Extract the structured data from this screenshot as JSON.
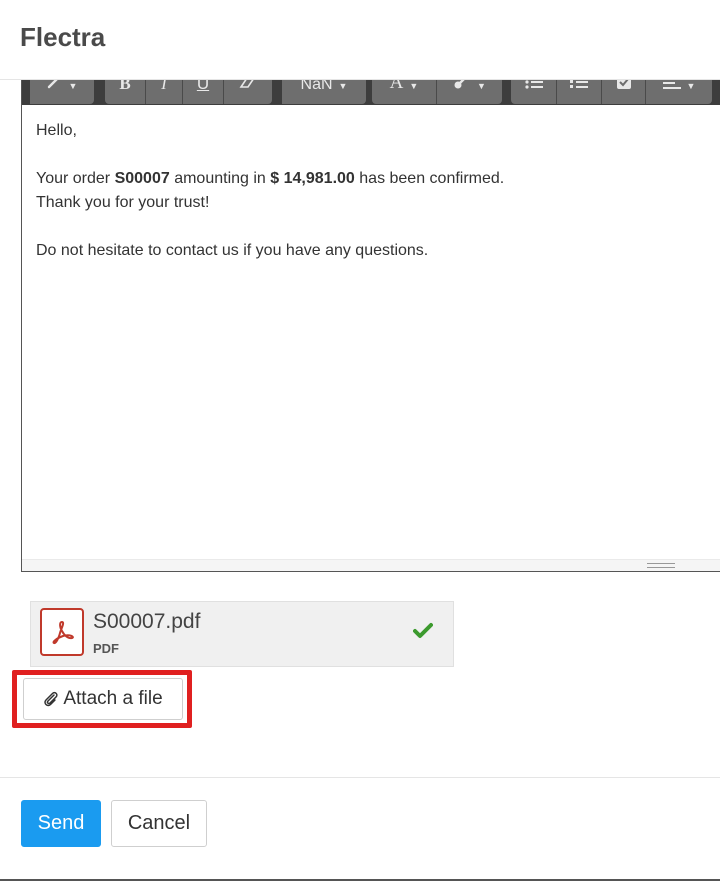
{
  "app": {
    "title": "Flectra"
  },
  "toolbar": {
    "font_size_label": "NaN",
    "bold_label": "B",
    "italic_label": "I",
    "underline_label": "U",
    "font_color_label": "A"
  },
  "message": {
    "greeting": "Hello,",
    "order_prefix": "Your order",
    "order_ref": "S00007",
    "order_mid": "amounting in",
    "order_amount": "$ 14,981.00",
    "order_suffix": "has been confirmed.",
    "thanks": "Thank you for your trust!",
    "contact": "Do not hesitate to contact us if you have any questions."
  },
  "attachment": {
    "file_name": "S00007.pdf",
    "file_type": "PDF"
  },
  "actions": {
    "attach_label": "Attach a file",
    "send_label": "Send",
    "cancel_label": "Cancel"
  },
  "colors": {
    "primary": "#1a9bf0",
    "highlight": "#e02020",
    "pdf_red": "#c0392b",
    "check_green": "#3c9a2e"
  }
}
